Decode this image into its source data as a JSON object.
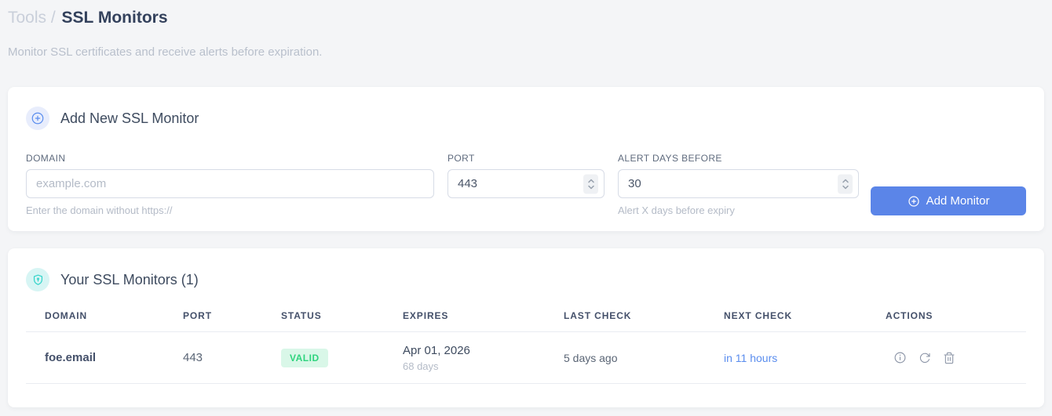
{
  "page": {
    "breadcrumb": {
      "parent": "Tools",
      "separator": " / ",
      "current": "SSL Monitors"
    },
    "subtitle": "Monitor SSL certificates and receive alerts before expiration."
  },
  "add_monitor_card": {
    "title": "Add New SSL Monitor",
    "header_icon": "plus-circle-icon",
    "fields": {
      "domain": {
        "label": "DOMAIN",
        "value": "",
        "placeholder": "example.com",
        "helper": "Enter the domain without https://"
      },
      "port": {
        "label": "PORT",
        "value": "443"
      },
      "alert_days": {
        "label": "ALERT DAYS BEFORE",
        "value": "30",
        "helper": "Alert X days before expiry"
      }
    },
    "submit_label": "Add Monitor"
  },
  "monitors_card": {
    "title": "Your SSL Monitors (1)",
    "header_icon": "shield-icon",
    "table": {
      "headers": [
        "DOMAIN",
        "PORT",
        "STATUS",
        "EXPIRES",
        "LAST CHECK",
        "NEXT CHECK",
        "ACTIONS"
      ],
      "rows": [
        {
          "domain": "foe.email",
          "port": "443",
          "status": "VALID",
          "expires_date": "Apr 01, 2026",
          "expires_days": "68 days",
          "last_check": "5 days ago",
          "next_check": "in 11 hours",
          "action_icons": [
            "info-icon",
            "refresh-icon",
            "trash-icon"
          ]
        }
      ]
    }
  },
  "colors": {
    "accent_blue": "#5b85e8",
    "link_blue": "#5a8dee",
    "status_valid_text": "#2ed47e",
    "status_valid_bg": "#d9f7e8",
    "teal_icon": "#2bd2c8",
    "page_bg": "#f4f5f7"
  }
}
